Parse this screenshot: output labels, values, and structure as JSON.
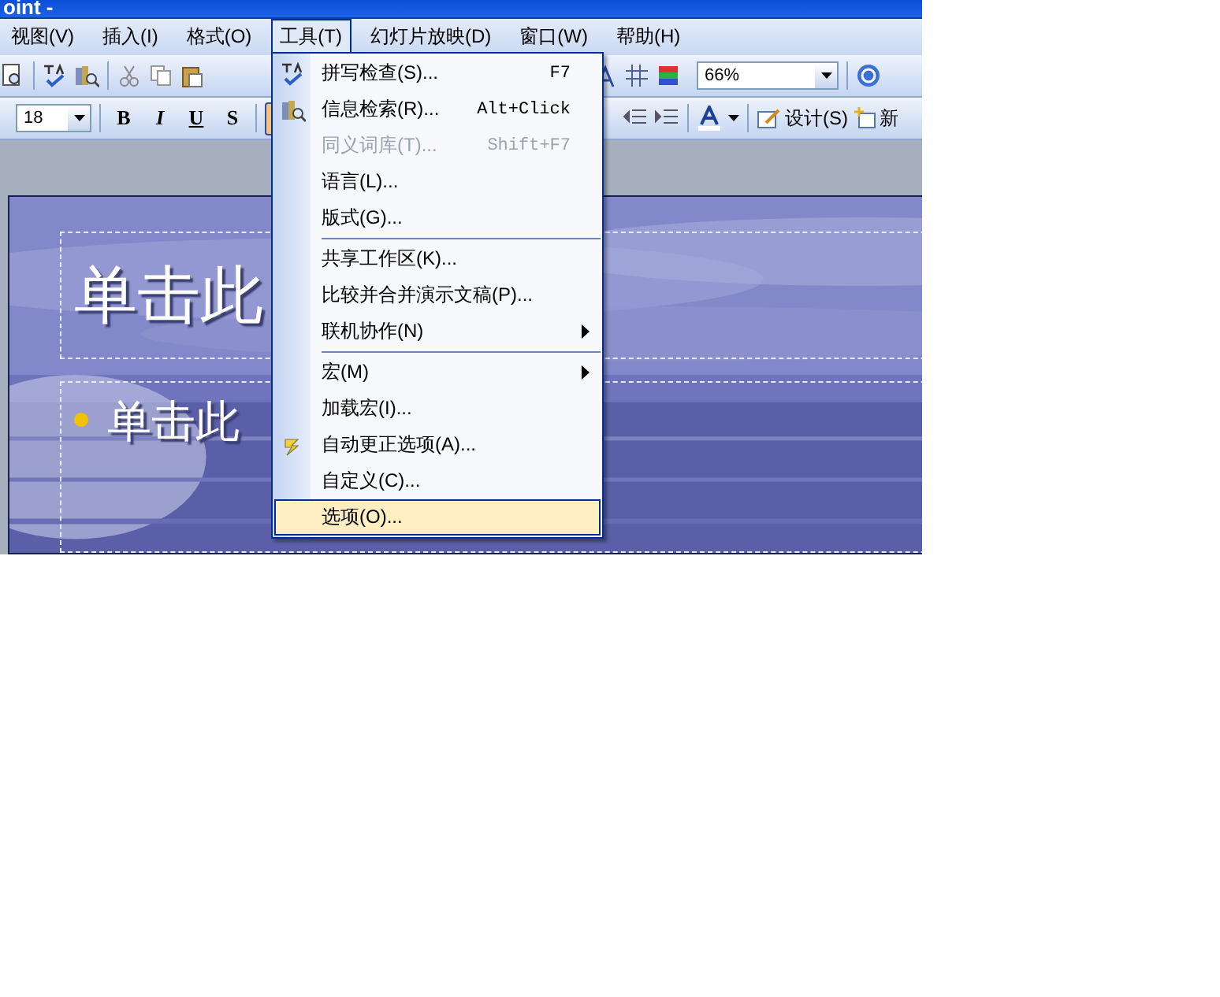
{
  "window": {
    "title": "oint -"
  },
  "menu_bar": [
    {
      "label": "视图(V)",
      "selected": false
    },
    {
      "label": "插入(I)",
      "selected": false
    },
    {
      "label": "格式(O)",
      "selected": false
    },
    {
      "label": "工具(T)",
      "selected": true
    },
    {
      "label": "幻灯片放映(D)",
      "selected": false
    },
    {
      "label": "窗口(W)",
      "selected": false
    },
    {
      "label": "帮助(H)",
      "selected": false
    }
  ],
  "standard_toolbar": {
    "zoom": "66%"
  },
  "formatting_toolbar": {
    "font_size": "18",
    "styles": [
      {
        "label": "B",
        "on": false
      },
      {
        "label": "I",
        "on": false
      },
      {
        "label": "U",
        "on": false
      },
      {
        "label": "S",
        "on": false
      }
    ],
    "align_left_on": true,
    "design_button": "设计(S)",
    "new_slide_button": "新"
  },
  "tools_menu": {
    "items": [
      {
        "kind": "item",
        "label": "拼写检查(S)...",
        "shortcut": "F7",
        "disabled": false,
        "submenu": false,
        "selected": false
      },
      {
        "kind": "item",
        "label": "信息检索(R)...",
        "shortcut": "Alt+Click",
        "disabled": false,
        "submenu": false,
        "selected": false
      },
      {
        "kind": "item",
        "label": "同义词库(T)...",
        "shortcut": "Shift+F7",
        "disabled": true,
        "submenu": false,
        "selected": false
      },
      {
        "kind": "item",
        "label": "语言(L)...",
        "disabled": false,
        "submenu": false,
        "selected": false
      },
      {
        "kind": "item",
        "label": "版式(G)...",
        "disabled": false,
        "submenu": false,
        "selected": false
      },
      {
        "kind": "separator"
      },
      {
        "kind": "item",
        "label": "共享工作区(K)...",
        "disabled": false,
        "submenu": false,
        "selected": false
      },
      {
        "kind": "item",
        "label": "比较并合并演示文稿(P)...",
        "disabled": false,
        "submenu": false,
        "selected": false
      },
      {
        "kind": "item",
        "label": "联机协作(N)",
        "disabled": false,
        "submenu": true,
        "selected": false
      },
      {
        "kind": "separator"
      },
      {
        "kind": "item",
        "label": "宏(M)",
        "disabled": false,
        "submenu": true,
        "selected": false
      },
      {
        "kind": "item",
        "label": "加载宏(I)...",
        "disabled": false,
        "submenu": false,
        "selected": false
      },
      {
        "kind": "item",
        "label": "自动更正选项(A)...",
        "disabled": false,
        "submenu": false,
        "selected": false
      },
      {
        "kind": "item",
        "label": "自定义(C)...",
        "disabled": false,
        "submenu": false,
        "selected": false
      },
      {
        "kind": "item",
        "label": "选项(O)...",
        "disabled": false,
        "submenu": false,
        "selected": true
      }
    ]
  },
  "slide": {
    "title": "单击此",
    "bullet": "单击此"
  }
}
